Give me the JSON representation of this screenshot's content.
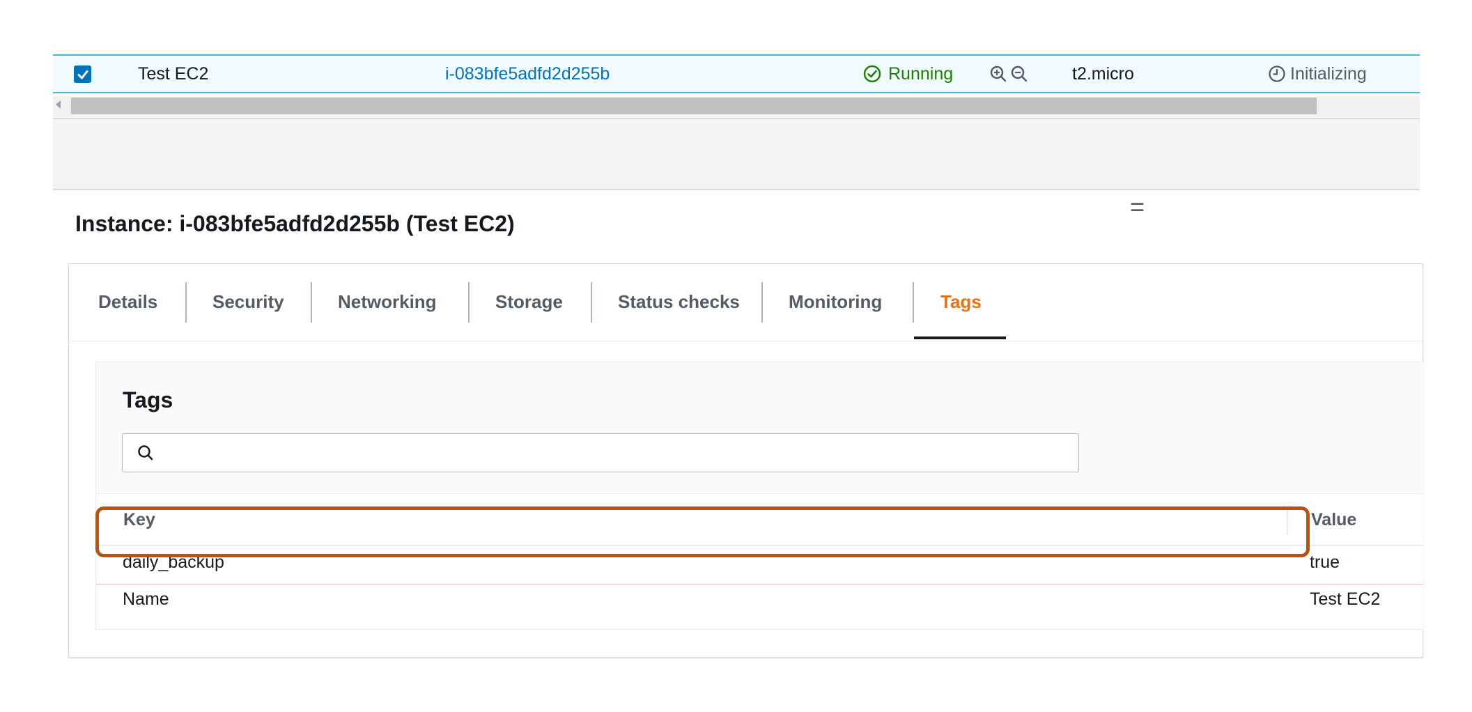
{
  "instance_row": {
    "name": "Test EC2",
    "instance_id": "i-083bfe5adfd2d255b",
    "state": "Running",
    "state_icon": "check-circle-icon",
    "zoom_icons": [
      "zoom-in-icon",
      "zoom-out-icon"
    ],
    "instance_type": "t2.micro",
    "status_check": "Initializing",
    "status_icon": "clock-icon",
    "selected": true
  },
  "details": {
    "title": "Instance: i-083bfe5adfd2d255b (Test EC2)",
    "resize_glyph": "=",
    "tabs": [
      {
        "label": "Details",
        "active": false
      },
      {
        "label": "Security",
        "active": false
      },
      {
        "label": "Networking",
        "active": false
      },
      {
        "label": "Storage",
        "active": false
      },
      {
        "label": "Status checks",
        "active": false
      },
      {
        "label": "Monitoring",
        "active": false
      },
      {
        "label": "Tags",
        "active": true
      }
    ]
  },
  "tags": {
    "title": "Tags",
    "search_placeholder": "",
    "columns": {
      "key": "Key",
      "value": "Value"
    },
    "rows": [
      {
        "key": "daily_backup",
        "value": "true"
      },
      {
        "key": "Name",
        "value": "Test EC2"
      }
    ]
  },
  "colors": {
    "link": "#0073bb",
    "running": "#1d8102",
    "active_tab": "#ec7211",
    "highlight": "#c0510a",
    "selected_row_bg": "#f1faff"
  }
}
